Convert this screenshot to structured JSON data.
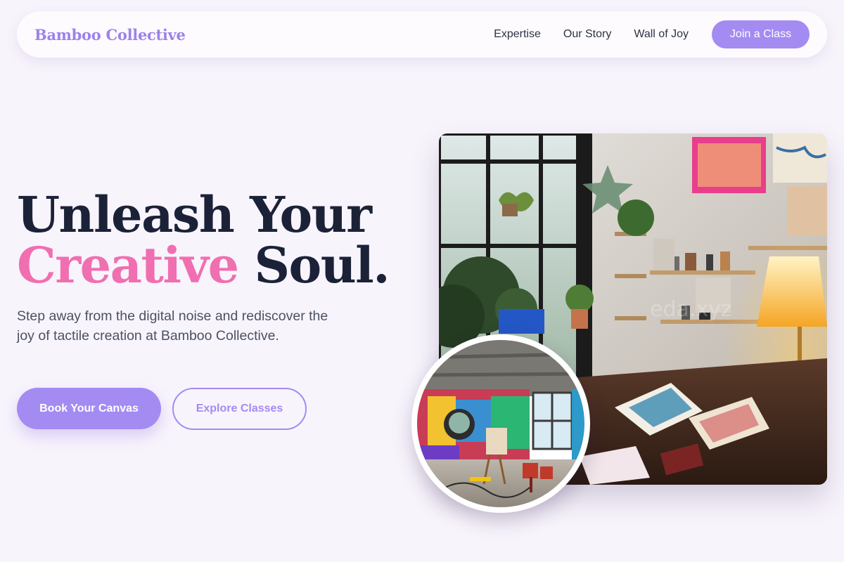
{
  "nav": {
    "brand": "Bamboo Collective",
    "links": [
      {
        "label": "Expertise"
      },
      {
        "label": "Our Story"
      },
      {
        "label": "Wall of Joy"
      }
    ],
    "cta": "Join a Class"
  },
  "hero": {
    "title_line1": "Unleash Your",
    "title_accent": "Creative",
    "title_line2_rest": " Soul.",
    "subtitle": "Step away from the digital noise and rediscover the joy of tactile creation at Bamboo Collective.",
    "primary_button": "Book Your Canvas",
    "secondary_button": "Explore Classes"
  },
  "colors": {
    "accent": "#a48bf2",
    "pink": "#f06fb0",
    "heading": "#1b2238",
    "background": "#f8f4fc"
  }
}
